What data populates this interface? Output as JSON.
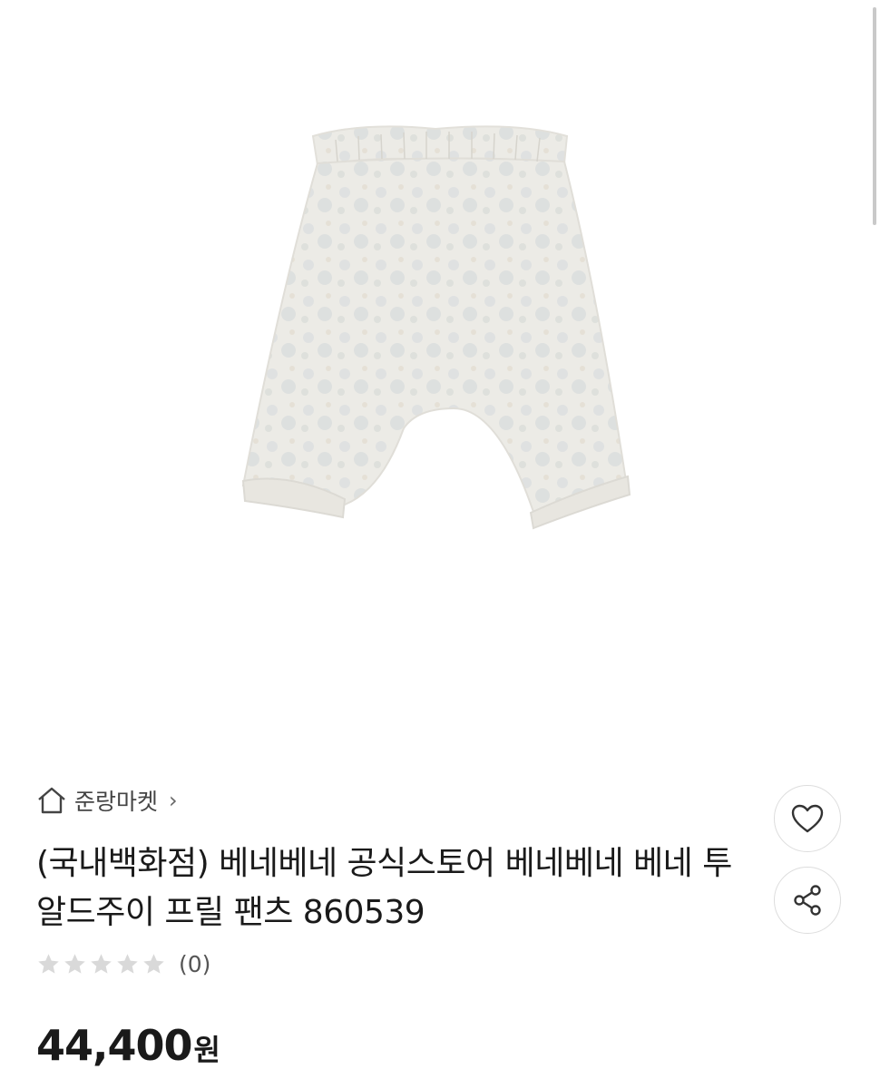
{
  "product": {
    "image_alt": "product-photo-frill-pants",
    "store_name": "준랑마켓",
    "title": "(국내백화점) 베네베네 공식스토어 베네베네 베네 투알드주이 프릴 팬츠 860539",
    "rating": {
      "stars_filled": 0,
      "stars_total": 5,
      "review_count": "(0)"
    },
    "price": {
      "value": "44,400",
      "unit": "원"
    }
  },
  "icons": {
    "store": "home-icon",
    "store_chevron": "chevron-right-icon",
    "like": "heart-icon",
    "share": "share-icon",
    "rating": "star-icon"
  },
  "colors": {
    "star_empty": "#d9d9d9",
    "text_primary": "#1a1a1a",
    "border": "#dddddd"
  }
}
